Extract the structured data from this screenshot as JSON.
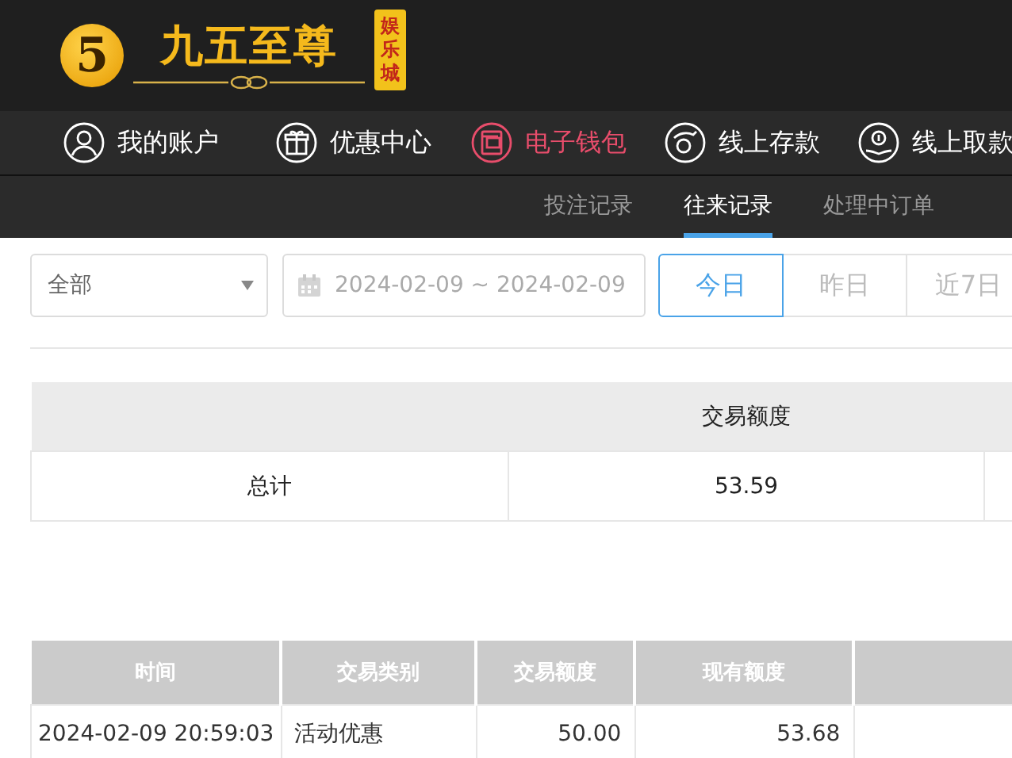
{
  "logo": {
    "mark": "5",
    "name": "九五至尊",
    "badge": "娱乐城"
  },
  "nav": [
    {
      "label": "我的账户",
      "selected": false
    },
    {
      "label": "优惠中心",
      "selected": false
    },
    {
      "label": "电子钱包",
      "selected": true
    },
    {
      "label": "线上存款",
      "selected": false
    },
    {
      "label": "线上取款",
      "selected": false
    }
  ],
  "subtabs": [
    {
      "label": "投注记录",
      "selected": false
    },
    {
      "label": "往来记录",
      "selected": true
    },
    {
      "label": "处理中订单",
      "selected": false
    }
  ],
  "filter": {
    "type": "全部",
    "date_range": "2024-02-09 ~ 2024-02-09",
    "quick": [
      {
        "label": "今日",
        "selected": true
      },
      {
        "label": "昨日",
        "selected": false
      },
      {
        "label": "近7日",
        "selected": false
      }
    ]
  },
  "summary": {
    "columns": [
      "",
      "交易额度"
    ],
    "rows": [
      [
        "总计",
        "53.59"
      ]
    ]
  },
  "records": {
    "columns": [
      "时间",
      "交易类别",
      "交易额度",
      "现有额度"
    ],
    "rows": [
      [
        "2024-02-09 20:59:03",
        "活动优惠",
        "50.00",
        "53.68"
      ]
    ]
  }
}
